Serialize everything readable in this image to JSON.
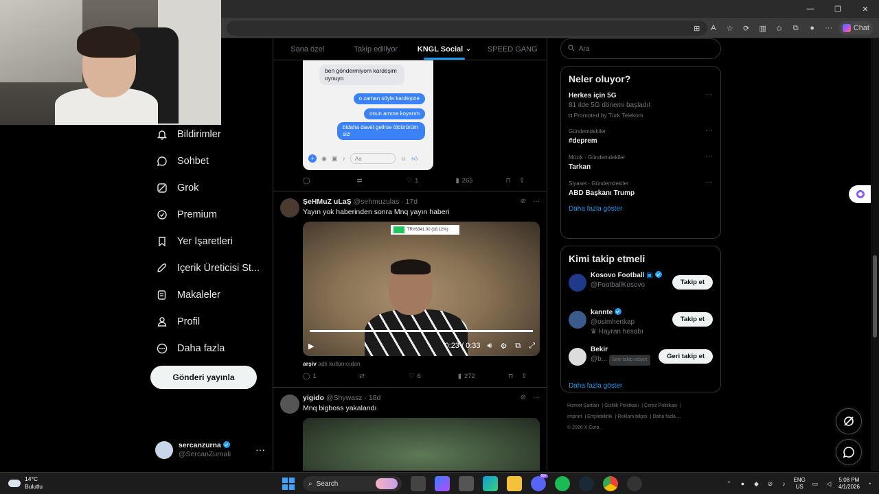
{
  "browser": {
    "window_controls": [
      "—",
      "❐",
      "✕"
    ],
    "chat_label": "Chat"
  },
  "nav": {
    "items": [
      {
        "label": "Bildirimler",
        "icon": "bell-icon"
      },
      {
        "label": "Sohbet",
        "icon": "chat-bubble-icon"
      },
      {
        "label": "Grok",
        "icon": "grok-icon"
      },
      {
        "label": "Premium",
        "icon": "premium-icon"
      },
      {
        "label": "Yer İşaretleri",
        "icon": "bookmark-icon"
      },
      {
        "label": "İçerik Üreticisi St...",
        "icon": "rocket-icon"
      },
      {
        "label": "Makaleler",
        "icon": "article-icon"
      },
      {
        "label": "Profil",
        "icon": "person-icon"
      },
      {
        "label": "Daha fazla",
        "icon": "more-circle-icon"
      }
    ],
    "post_button": "Gönderi yayınla",
    "account": {
      "name": "sercanzurna",
      "handle": "@SercanZurnali",
      "more": "···"
    }
  },
  "feed": {
    "tabs": [
      {
        "label": "Sana özel"
      },
      {
        "label": "Takip ediliyor"
      },
      {
        "label": "KNGL Social"
      },
      {
        "label": "SPEED GANG"
      }
    ],
    "post1": {
      "chat": {
        "msg_left": "ben göndermiyom kardeşim oynuyo",
        "msg_r1": "o zaman söyle kardeşine",
        "msg_r2": "onun amına koyarım",
        "msg_r3": "bidaha davet gelirse öldürürüm sizi",
        "input_placeholder": "Aa"
      },
      "views": "265",
      "likes": "1"
    },
    "post2": {
      "name": "ŞeHMuZ uLaŞ",
      "handle": "@sehmuzulas",
      "time": "· 17d",
      "text": "Yayın yok haberinden sonra Mnq yayın haberi",
      "video_time": "0:23 / 0:33",
      "screen_text": "TRY6341.00 (18.12%)",
      "archive_bold": "arşiv",
      "archive_rest": " adlı kullanıcıdan",
      "replies": "1",
      "likes": "6",
      "views": "272",
      "video_progress": 1.0
    },
    "post3": {
      "name": "yigido",
      "handle": "@Shywasz",
      "time": "· 18d",
      "text": "Mnq bigboss yakalandı"
    }
  },
  "right": {
    "search_placeholder": "Ara",
    "trends_title": "Neler oluyor?",
    "trends": [
      {
        "ctx": "",
        "title": "Herkes için 5G",
        "sub": "81 ilde 5G dönemi başladı!",
        "promo": "Promoted by Türk Telekom"
      },
      {
        "ctx": "Gündemdekiler",
        "title": "#deprem",
        "sub": "",
        "promo": ""
      },
      {
        "ctx": "Müzik · Gündemdekiler",
        "title": "Tarkan",
        "sub": "",
        "promo": ""
      },
      {
        "ctx": "Siyaset · Gündemdekiler",
        "title": "ABD Başkanı Trump",
        "sub": "",
        "promo": ""
      }
    ],
    "show_more": "Daha fazla göster",
    "who_title": "Kimi takip etmeli",
    "who": [
      {
        "name": "Kosovo Football",
        "handle": "@FootballKosovo",
        "extra": "",
        "button": "Takip et",
        "avatar_color": "#1f3a8a"
      },
      {
        "name": "kannte",
        "handle": "@osimhenkap",
        "extra": "Hayran hesabı",
        "button": "Takip et",
        "avatar_color": "#3b5b8c"
      },
      {
        "name": "Bekir",
        "handle": "@b...",
        "extra": "Seni takip ediyor",
        "button": "Geri takip et",
        "avatar_color": "#dcdcdc"
      }
    ],
    "footer": [
      "Hizmet Şartları",
      "Gizlilik Politikası",
      "Çerez Politikası",
      "Imprint",
      "Erişilebilirlik",
      "Reklam bilgisi",
      "Daha fazla ...",
      "© 2026 X Corp."
    ]
  },
  "taskbar": {
    "temp": "14°C",
    "weather": "Bulutlu",
    "search": "Search",
    "lang1": "ENG",
    "lang2": "US",
    "time": "5:08 PM",
    "date": "4/1/2026",
    "badge": "99+"
  }
}
